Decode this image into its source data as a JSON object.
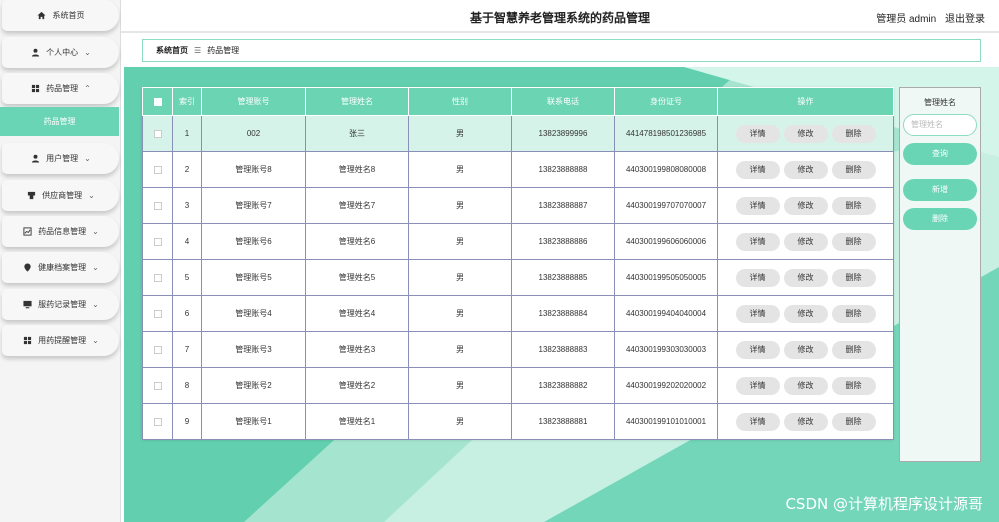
{
  "sidebar": {
    "items": [
      {
        "label": "系统首页",
        "icon": "home-icon",
        "has_chevron": false
      },
      {
        "label": "个人中心",
        "icon": "user-icon",
        "has_chevron": true
      },
      {
        "label": "药品管理",
        "icon": "grid-icon",
        "has_chevron": true,
        "expanded": true
      },
      {
        "label": "用户管理",
        "icon": "user-icon",
        "has_chevron": true
      },
      {
        "label": "供应商管理",
        "icon": "shop-icon",
        "has_chevron": true
      },
      {
        "label": "药品信息管理",
        "icon": "chart-icon",
        "has_chevron": true
      },
      {
        "label": "健康档案管理",
        "icon": "pin-icon",
        "has_chevron": true
      },
      {
        "label": "服药记录管理",
        "icon": "monitor-icon",
        "has_chevron": true
      },
      {
        "label": "用药提醒管理",
        "icon": "grid-icon",
        "has_chevron": true
      }
    ],
    "active_sub": "药品管理"
  },
  "header": {
    "title": "基于智慧养老管理系统的药品管理",
    "user": "管理员 admin",
    "logout": "退出登录"
  },
  "breadcrumb": {
    "home": "系统首页",
    "sep": "☰",
    "current": "药品管理"
  },
  "table": {
    "headers": [
      "索引",
      "管理账号",
      "管理姓名",
      "性别",
      "联系电话",
      "身份证号",
      "操作"
    ],
    "rows": [
      {
        "index": "1",
        "account": "002",
        "name": "张三",
        "gender": "男",
        "phone": "13823899996",
        "id": "441478198501236985"
      },
      {
        "index": "2",
        "account": "管理账号8",
        "name": "管理姓名8",
        "gender": "男",
        "phone": "13823888888",
        "id": "440300199808080008"
      },
      {
        "index": "3",
        "account": "管理账号7",
        "name": "管理姓名7",
        "gender": "男",
        "phone": "13823888887",
        "id": "440300199707070007"
      },
      {
        "index": "4",
        "account": "管理账号6",
        "name": "管理姓名6",
        "gender": "男",
        "phone": "13823888886",
        "id": "440300199606060006"
      },
      {
        "index": "5",
        "account": "管理账号5",
        "name": "管理姓名5",
        "gender": "男",
        "phone": "13823888885",
        "id": "440300199505050005"
      },
      {
        "index": "6",
        "account": "管理账号4",
        "name": "管理姓名4",
        "gender": "男",
        "phone": "13823888884",
        "id": "440300199404040004"
      },
      {
        "index": "7",
        "account": "管理账号3",
        "name": "管理姓名3",
        "gender": "男",
        "phone": "13823888883",
        "id": "440300199303030003"
      },
      {
        "index": "8",
        "account": "管理账号2",
        "name": "管理姓名2",
        "gender": "男",
        "phone": "13823888882",
        "id": "440300199202020002"
      },
      {
        "index": "9",
        "account": "管理账号1",
        "name": "管理姓名1",
        "gender": "男",
        "phone": "13823888881",
        "id": "440300199101010001"
      }
    ],
    "actions": {
      "detail": "详情",
      "edit": "修改",
      "delete": "删除"
    }
  },
  "panel": {
    "label": "管理姓名",
    "placeholder": "管理姓名",
    "search": "查询",
    "add": "新增",
    "delete": "删除"
  },
  "watermark": "CSDN @计算机程序设计源哥",
  "colors": {
    "accent": "#69d5b4",
    "header_border": "#e6e6e6"
  }
}
